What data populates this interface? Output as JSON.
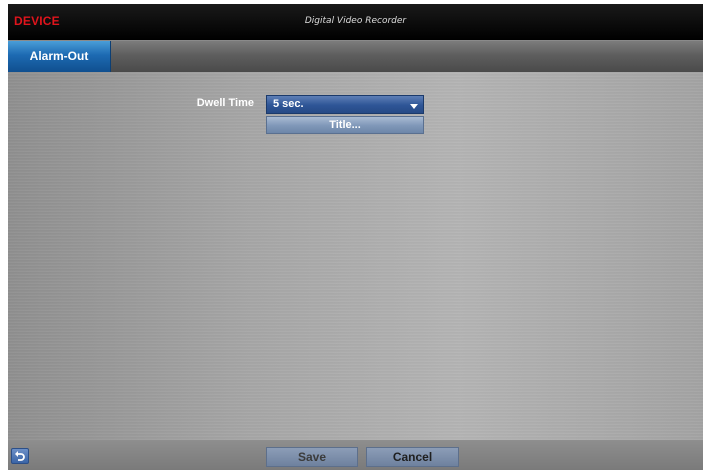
{
  "app": {
    "section_title": "DEVICE",
    "window_title": "Digital Video Recorder"
  },
  "tabs": [
    {
      "label": "Alarm-Out",
      "active": true
    }
  ],
  "form": {
    "dwell_time": {
      "label": "Dwell Time",
      "selected": "5 sec."
    },
    "title_button": "Title..."
  },
  "footer": {
    "back_icon": "back-arrow-icon",
    "save_label": "Save",
    "cancel_label": "Cancel"
  },
  "colors": {
    "accent_red": "#e0141c",
    "tab_blue": "#1d6ab2",
    "select_blue": "#2e5596"
  }
}
